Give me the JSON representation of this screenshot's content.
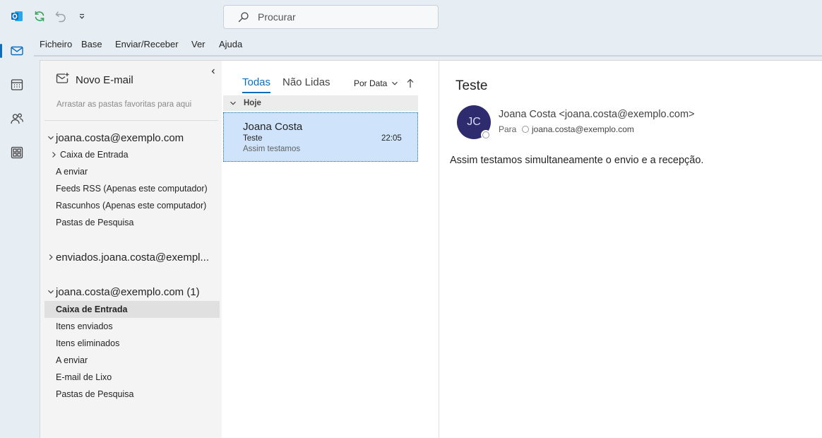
{
  "titlebar": {
    "logo_icon": "outlook-logo-icon",
    "sync_icon": "sync-icon",
    "undo_icon": "undo-icon",
    "dropdown_icon": "chevron-down-icon",
    "search": {
      "placeholder": "Procurar",
      "icon": "search-icon"
    }
  },
  "navrail": {
    "items": [
      {
        "name": "mail",
        "icon": "mail-icon",
        "active": true
      },
      {
        "name": "calendar",
        "icon": "calendar-icon"
      },
      {
        "name": "people",
        "icon": "people-icon"
      },
      {
        "name": "apps",
        "icon": "apps-icon"
      }
    ]
  },
  "ribbon": {
    "menu": [
      "Ficheiro",
      "Base",
      "Enviar/Receber",
      "Ver",
      "Ajuda"
    ]
  },
  "folderpane": {
    "new_email_label": "Novo E-mail",
    "favorites_hint": "Arrastar as pastas favoritas para aqui",
    "accounts": [
      {
        "name": "joana.costa@exemplo.com",
        "expanded": true,
        "folders": [
          {
            "label": "Caixa de Entrada",
            "has_children": true
          },
          {
            "label": "A enviar"
          },
          {
            "label": "Feeds RSS (Apenas este computador)"
          },
          {
            "label": "Rascunhos (Apenas este computador)"
          },
          {
            "label": "Pastas de Pesquisa"
          }
        ]
      },
      {
        "name": "enviados.joana.costa@exempl...",
        "expanded": false
      },
      {
        "name": "joana.costa@exemplo.com (1)",
        "expanded": true,
        "folders": [
          {
            "label": "Caixa de Entrada",
            "selected": true
          },
          {
            "label": "Itens enviados"
          },
          {
            "label": "Itens eliminados"
          },
          {
            "label": "A enviar"
          },
          {
            "label": "E-mail de Lixo"
          },
          {
            "label": "Pastas de Pesquisa"
          }
        ]
      }
    ]
  },
  "msglist": {
    "filters": {
      "all": "Todas",
      "unread": "Não Lidas"
    },
    "sort_label": "Por Data",
    "group_label": "Hoje",
    "messages": [
      {
        "sender": "Joana Costa",
        "subject": "Teste",
        "time": "22:05",
        "preview": "Assim testamos",
        "selected": true
      }
    ]
  },
  "reading": {
    "subject": "Teste",
    "avatar_initials": "JC",
    "avatar_color": "#2e2c6e",
    "from": "Joana Costa <joana.costa@exemplo.com>",
    "to_label": "Para",
    "to_address": "joana.costa@exemplo.com",
    "body": "Assim testamos simultaneamente o envio e a recepção."
  },
  "colors": {
    "accent": "#0f6cbd",
    "selected_message": "#cfe4fa"
  }
}
